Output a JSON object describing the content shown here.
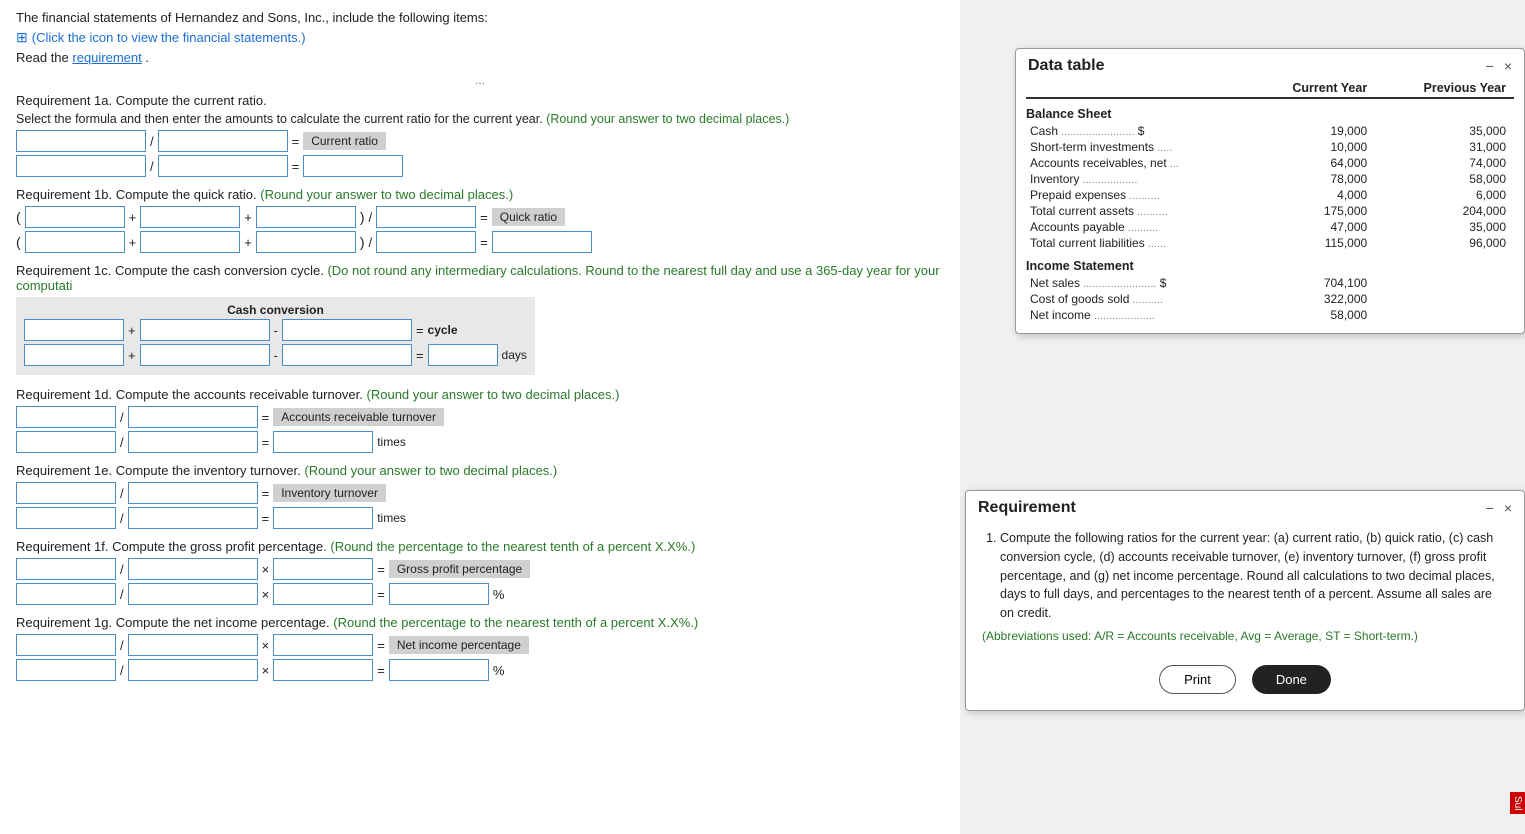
{
  "intro": {
    "text": "The financial statements of Hernandez and Sons, Inc., include the following items:",
    "icon_text": "(Click the icon to view the financial statements.)",
    "read_req": "Read the",
    "requirement_link": "requirement",
    "read_req_end": "."
  },
  "divider": "...",
  "requirements": {
    "1a": {
      "title": "Requirement 1a.",
      "desc": " Compute the current ratio.",
      "instruction": "Select the formula and then enter the amounts to calculate the current ratio for the current year.",
      "instruction_green": "(Round your answer to two decimal places.)",
      "label": "Current ratio"
    },
    "1b": {
      "title": "Requirement 1b.",
      "desc": " Compute the quick ratio.",
      "instruction_green": "(Round your answer to two decimal places.)",
      "label": "Quick ratio"
    },
    "1c": {
      "title": "Requirement 1c.",
      "desc": " Compute the cash conversion cycle.",
      "instruction_green": "(Do not round any intermediary calculations. Round to the nearest full day and use a 365-day year for your computati",
      "label1": "Cash conversion",
      "label2": "cycle",
      "label3": "days"
    },
    "1d": {
      "title": "Requirement 1d.",
      "desc": " Compute the accounts receivable turnover.",
      "instruction_green": "(Round your answer to two decimal places.)",
      "label": "Accounts receivable turnover",
      "label2": "times"
    },
    "1e": {
      "title": "Requirement 1e.",
      "desc": " Compute the inventory turnover.",
      "instruction_green": "(Round your answer to two decimal places.)",
      "label": "Inventory turnover",
      "label2": "times"
    },
    "1f": {
      "title": "Requirement 1f.",
      "desc": " Compute the gross profit percentage.",
      "instruction_green": "(Round the percentage to the nearest tenth of a percent X.X%.)",
      "label": "Gross profit percentage",
      "label2": "%"
    },
    "1g": {
      "title": "Requirement 1g.",
      "desc": " Compute the net income percentage.",
      "instruction_green": "(Round the percentage to the nearest tenth of a percent X.X%.)",
      "label": "Net income percentage",
      "label2": "%"
    }
  },
  "data_table": {
    "title": "Data table",
    "headers": [
      "",
      "Current Year",
      "Previous Year"
    ],
    "sections": [
      {
        "name": "Balance Sheet",
        "rows": [
          {
            "label": "Cash",
            "dots": "........................",
            "symbol": "$",
            "current": "19,000",
            "prev_symbol": "$",
            "prev": "35,000"
          },
          {
            "label": "Short-term investments",
            "dots": ".....",
            "symbol": "",
            "current": "10,000",
            "prev": "31,000"
          },
          {
            "label": "Accounts receivables, net",
            "dots": "...",
            "symbol": "",
            "current": "64,000",
            "prev": "74,000"
          },
          {
            "label": "Inventory",
            "dots": "..................",
            "symbol": "",
            "current": "78,000",
            "prev": "58,000"
          },
          {
            "label": "Prepaid expenses",
            "dots": "..........",
            "symbol": "",
            "current": "4,000",
            "prev": "6,000"
          },
          {
            "label": "Total current assets",
            "dots": "..........",
            "symbol": "",
            "current": "175,000",
            "prev": "204,000"
          },
          {
            "label": "Accounts payable",
            "dots": "..........",
            "symbol": "",
            "current": "47,000",
            "prev": "35,000"
          },
          {
            "label": "Total current liabilities",
            "dots": "......",
            "symbol": "",
            "current": "115,000",
            "prev": "96,000"
          }
        ]
      },
      {
        "name": "Income Statement",
        "rows": [
          {
            "label": "Net sales",
            "dots": "........................",
            "symbol": "$",
            "current": "704,100",
            "prev": ""
          },
          {
            "label": "Cost of goods sold",
            "dots": "..........",
            "symbol": "",
            "current": "322,000",
            "prev": ""
          },
          {
            "label": "Net income",
            "dots": "....................",
            "symbol": "",
            "current": "58,000",
            "prev": ""
          }
        ]
      }
    ],
    "controls": {
      "minimize": "−",
      "close": "×"
    }
  },
  "requirement_panel": {
    "title": "Requirement",
    "controls": {
      "minimize": "−",
      "close": "×"
    },
    "body": "Compute the following ratios for the current year: (a) current ratio, (b) quick ratio, (c) cash conversion cycle, (d) accounts receivable turnover, (e) inventory turnover, (f) gross profit percentage, and (g) net income percentage. Round all calculations to two decimal places, days to full days, and percentages to the nearest tenth of a percent. Assume all sales are on credit.",
    "abbrev": "(Abbreviations used: A/R = Accounts receivable, Avg = Average, ST = Short-term.)",
    "print_label": "Print",
    "done_label": "Done"
  }
}
